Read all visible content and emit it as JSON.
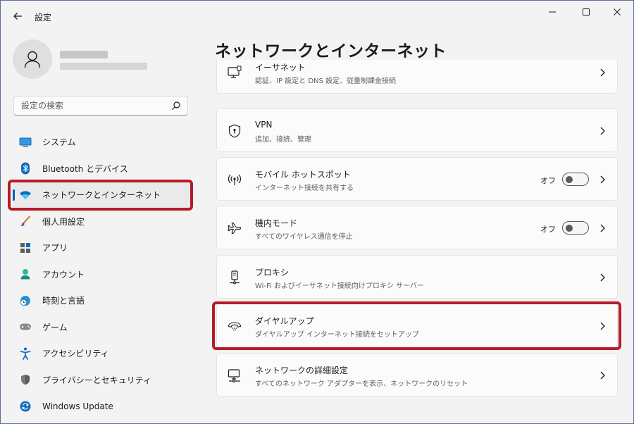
{
  "window": {
    "title": "設定"
  },
  "search": {
    "placeholder": "設定の検索"
  },
  "sidebar": {
    "items": [
      {
        "label": "システム",
        "icon": "monitor-icon"
      },
      {
        "label": "Bluetooth とデバイス",
        "icon": "bluetooth-icon"
      },
      {
        "label": "ネットワークとインターネット",
        "icon": "wifi-icon",
        "active": true
      },
      {
        "label": "個人用設定",
        "icon": "brush-icon"
      },
      {
        "label": "アプリ",
        "icon": "apps-icon"
      },
      {
        "label": "アカウント",
        "icon": "account-icon"
      },
      {
        "label": "時刻と言語",
        "icon": "globe-clock-icon"
      },
      {
        "label": "ゲーム",
        "icon": "gamepad-icon"
      },
      {
        "label": "アクセシビリティ",
        "icon": "accessibility-icon"
      },
      {
        "label": "プライバシーとセキュリティ",
        "icon": "shield-icon"
      },
      {
        "label": "Windows Update",
        "icon": "update-icon"
      }
    ]
  },
  "main": {
    "title": "ネットワークとインターネット",
    "cards": [
      {
        "title": "イーサネット",
        "subtitle": "認証、IP 設定と DNS 設定、従量制課金接続",
        "icon": "ethernet-icon"
      },
      {
        "title": "VPN",
        "subtitle": "追加、接続、管理",
        "icon": "vpn-shield-icon"
      },
      {
        "title": "モバイル ホットスポット",
        "subtitle": "インターネット接続を共有する",
        "icon": "hotspot-icon",
        "toggle": "オフ"
      },
      {
        "title": "機内モード",
        "subtitle": "すべてのワイヤレス通信を停止",
        "icon": "airplane-icon",
        "toggle": "オフ"
      },
      {
        "title": "プロキシ",
        "subtitle": "Wi-Fi およびイーサネット接続向けプロキシ サーバー",
        "icon": "proxy-icon"
      },
      {
        "title": "ダイヤルアップ",
        "subtitle": "ダイヤルアップ インターネット接続をセットアップ",
        "icon": "dialup-icon"
      },
      {
        "title": "ネットワークの詳細設定",
        "subtitle": "すべてのネットワーク アダプターを表示、ネットワークのリセット",
        "icon": "network-settings-icon"
      }
    ]
  },
  "colors": {
    "accent": "#005fb8",
    "highlight": "#b51c2a",
    "background": "#f3f3f3",
    "card": "#fbfbfb"
  }
}
